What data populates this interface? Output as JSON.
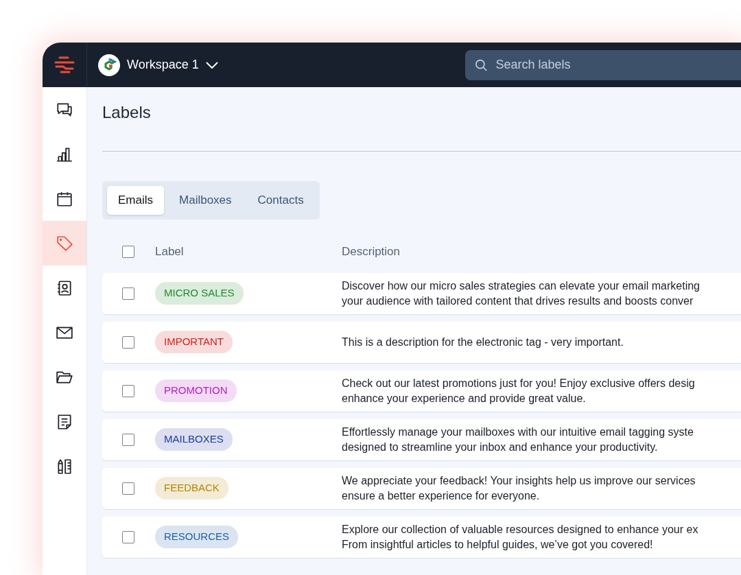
{
  "topbar": {
    "workspace": "Workspace 1",
    "search": {
      "placeholder": "Search labels"
    }
  },
  "sidebar": {
    "items": [
      {
        "selected": false
      },
      {
        "selected": false
      },
      {
        "selected": false
      },
      {
        "selected": true
      },
      {
        "selected": false
      },
      {
        "selected": false
      },
      {
        "selected": false
      },
      {
        "selected": false
      },
      {
        "selected": false
      }
    ]
  },
  "page": {
    "title": "Labels"
  },
  "tabs": [
    {
      "label": "Emails",
      "selected": true
    },
    {
      "label": "Mailboxes",
      "selected": false
    },
    {
      "label": "Contacts",
      "selected": false
    }
  ],
  "table": {
    "columns": [
      "Label",
      "Description"
    ],
    "header_checked": false,
    "rows": [
      {
        "label": "MICRO SALES",
        "color": "#1e8a2c",
        "checked": false,
        "description": "Discover how our micro sales strategies can elevate your email marketing\nyour audience with tailored content that drives results and boosts conver"
      },
      {
        "label": "IMPORTANT",
        "color": "#d0241f",
        "checked": false,
        "description": "This is a description for the electronic tag - very important."
      },
      {
        "label": "PROMOTION",
        "color": "#b11fc2",
        "checked": false,
        "description": "Check out our latest promotions just for you! Enjoy exclusive offers desig\nenhance your experience and provide great value."
      },
      {
        "label": "MAILBOXES",
        "color": "#1e3aa8",
        "checked": false,
        "description": "Effortlessly manage your mailboxes with our intuitive email tagging syste\ndesigned to streamline your inbox and enhance your productivity."
      },
      {
        "label": "FEEDBACK",
        "color": "#b98500",
        "checked": false,
        "description": "We appreciate your feedback! Your insights help us improve our services\nensure a better experience for everyone."
      },
      {
        "label": "RESOURCES",
        "color": "#1d5fa8",
        "checked": false,
        "description": "Explore our collection of valuable resources designed to enhance your ex\nFrom insightful articles to helpful guides, we’ve got you covered!"
      }
    ]
  }
}
